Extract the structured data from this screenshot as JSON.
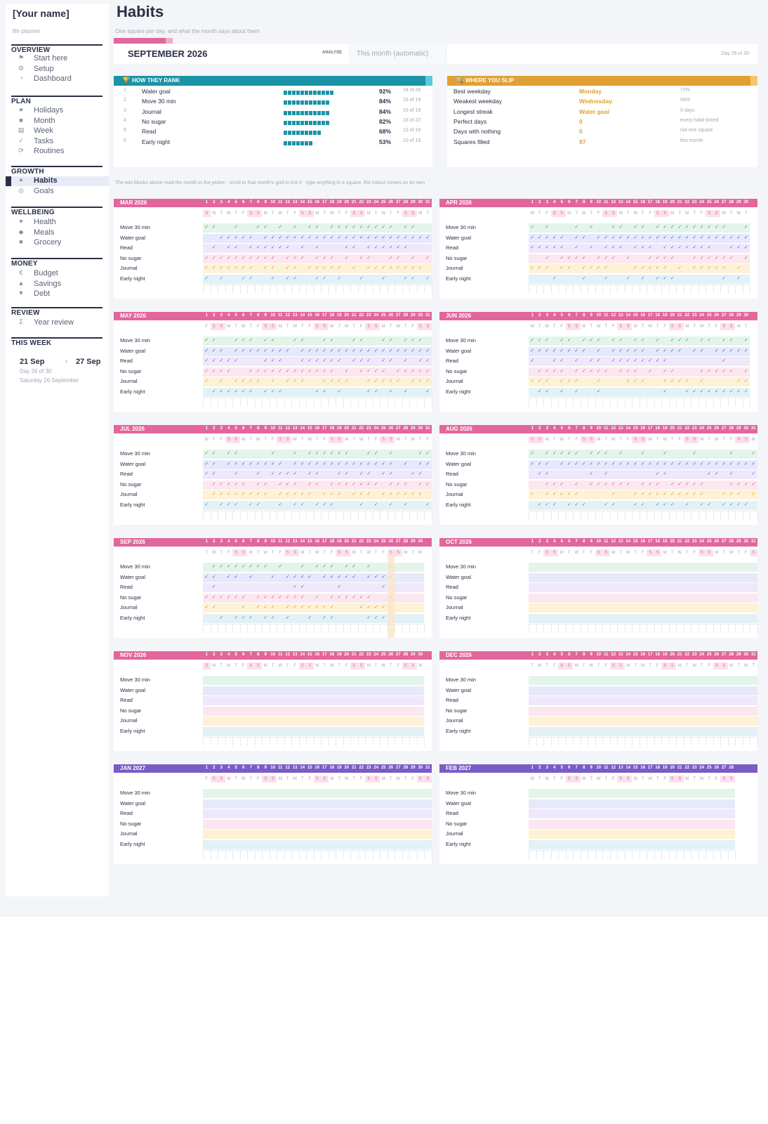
{
  "sidebar": {
    "name": "[Your name]",
    "subtitle": "life planner",
    "sections": [
      {
        "title": "OVERVIEW",
        "items": [
          {
            "label": "Start here",
            "icon": "⚑",
            "icon_name": "flag-icon"
          },
          {
            "label": "Setup",
            "icon": "⚙",
            "icon_name": "gear-icon"
          },
          {
            "label": "Dashboard",
            "icon": "◔",
            "icon_name": "dashboard-icon"
          }
        ]
      },
      {
        "title": "PLAN",
        "items": [
          {
            "label": "Holidays",
            "icon": "★",
            "icon_name": "star-icon"
          },
          {
            "label": "Month",
            "icon": "■",
            "icon_name": "month-icon"
          },
          {
            "label": "Week",
            "icon": "▤",
            "icon_name": "week-icon"
          },
          {
            "label": "Tasks",
            "icon": "✓",
            "icon_name": "check-icon"
          },
          {
            "label": "Routines",
            "icon": "⟳",
            "icon_name": "refresh-icon"
          }
        ]
      },
      {
        "title": "GROWTH",
        "items": [
          {
            "label": "Habits",
            "icon": "●",
            "icon_name": "dot-icon",
            "active": true
          },
          {
            "label": "Goals",
            "icon": "◎",
            "icon_name": "target-icon"
          }
        ]
      },
      {
        "title": "WELLBEING",
        "items": [
          {
            "label": "Health",
            "icon": "♥",
            "icon_name": "heart-icon"
          },
          {
            "label": "Meals",
            "icon": "◆",
            "icon_name": "meals-icon"
          },
          {
            "label": "Grocery",
            "icon": "■",
            "icon_name": "grocery-icon"
          }
        ]
      },
      {
        "title": "MONEY",
        "items": [
          {
            "label": "Budget",
            "icon": "€",
            "icon_name": "euro-icon"
          },
          {
            "label": "Savings",
            "icon": "▲",
            "icon_name": "savings-icon"
          },
          {
            "label": "Debt",
            "icon": "▼",
            "icon_name": "debt-icon"
          }
        ]
      },
      {
        "title": "REVIEW",
        "items": [
          {
            "label": "Year review",
            "icon": "Σ",
            "icon_name": "sigma-icon"
          }
        ]
      }
    ],
    "this_week": {
      "title": "THIS WEEK",
      "from": "21 Sep",
      "arrow": "›",
      "to": "27 Sep",
      "day": "Day 26 of 30",
      "date": "Saturday 26 September"
    }
  },
  "header": {
    "title": "Habits",
    "subtitle": "One square per day, and what the month says about them",
    "month": "SEPTEMBER 2026",
    "analyse_label": "ANALYSE",
    "auto_label": "This month (automatic)",
    "day_counter": "Day 26 of 30"
  },
  "rank": {
    "title": "HOW THEY RANK",
    "icon": "🏆",
    "rows": [
      {
        "rank": "1",
        "habit": "Water goal",
        "blocks": 12,
        "pct": "92%",
        "count": "24 of 26"
      },
      {
        "rank": "2",
        "habit": "Move 30 min",
        "blocks": 11,
        "pct": "84%",
        "count": "16 of 19"
      },
      {
        "rank": "3",
        "habit": "Journal",
        "blocks": 11,
        "pct": "84%",
        "count": "16 of 19"
      },
      {
        "rank": "4",
        "habit": "No sugar",
        "blocks": 11,
        "pct": "82%",
        "count": "18 of 22"
      },
      {
        "rank": "5",
        "habit": "Read",
        "blocks": 9,
        "pct": "68%",
        "count": "13 of 19"
      },
      {
        "rank": "6",
        "habit": "Early night",
        "blocks": 7,
        "pct": "53%",
        "count": "10 of 19"
      }
    ]
  },
  "slip": {
    "title": "WHERE YOU SLIP",
    "icon": "🔍",
    "rows": [
      {
        "label": "Best weekday",
        "value": "Monday",
        "note": "72%"
      },
      {
        "label": "Weakest weekday",
        "value": "Wednesday",
        "note": "54%"
      },
      {
        "label": "Longest streak",
        "value": "Water goal",
        "note": "9 days"
      },
      {
        "label": "Perfect days",
        "value": "0",
        "note": "every habit ticked"
      },
      {
        "label": "Days with nothing",
        "value": "0",
        "note": "not one square"
      },
      {
        "label": "Squares filled",
        "value": "97",
        "note": "this month"
      }
    ]
  },
  "note": "The two blocks above read the month in the picker  ·  scroll to that month's grid to tick it  ·  type anything in a square, the colour comes on its own",
  "habits": [
    "Move 30 min",
    "Water goal",
    "Read",
    "No sugar",
    "Journal",
    "Early night"
  ],
  "check_symbol": "✓",
  "colors": {
    "accent_pink": "#e2669b",
    "accent_teal": "#1b93a6",
    "accent_orange": "#e0a033",
    "accent_purple": "#7b5bc6",
    "bands": [
      "#e3f4ea",
      "#e6e9fb",
      "#efe8fb",
      "#fbe7ef",
      "#fdf1d6",
      "#e2f1f6"
    ],
    "checks": [
      "#2e9d5e",
      "#3f5bd1",
      "#7a4fc8",
      "#e0557f",
      "#d99a1c",
      "#2794ab"
    ]
  },
  "months": [
    {
      "name": "MAR 2026",
      "days": 31,
      "weekdays": "SMTWTFSSMTWTFSSMTWTFSSMTWTFSSMT",
      "filled": 31
    },
    {
      "name": "APR 2026",
      "days": 30,
      "weekdays": "WTFSSMTWTFSSMTWTFSSMTWTFSSMTWT",
      "filled": 30
    },
    {
      "name": "MAY 2026",
      "days": 31,
      "weekdays": "FSSMTWTFSSMTWTFSSMTWTFSSMTWTFSS",
      "filled": 31
    },
    {
      "name": "JUN 2026",
      "days": 30,
      "weekdays": "MTWTFSSMTWTFSSMTWTFSSMTWTFSSMT",
      "filled": 30
    },
    {
      "name": "JUL 2026",
      "days": 31,
      "weekdays": "WTFSSMTWTFSSMTWTFSSMTWTFSSMTWTF",
      "filled": 31
    },
    {
      "name": "AUG 2026",
      "days": 31,
      "weekdays": "SSMTWTFSSMTWTFSSMTWTFSSMTWTFSSM",
      "filled": 31
    },
    {
      "name": "SEP 2026",
      "days": 30,
      "weekdays": "TWTFSSMTWTFSSMTWTFSSMTWTFSSMTW",
      "filled": 26,
      "today": 26
    },
    {
      "name": "OCT 2026",
      "days": 31,
      "weekdays": "TFSSMTWTFSSMTWTFSSMTWTFSSMTWTFS",
      "filled": 0
    },
    {
      "name": "NOV 2026",
      "days": 30,
      "weekdays": "SMTWTFSSMTWTFSSMTWTFSSMTWTFSSM",
      "filled": 0
    },
    {
      "name": "DEC 2026",
      "days": 31,
      "weekdays": "TWTFSSMTWTFSSMTWTFSSMTWTFSSMTWT",
      "filled": 0
    },
    {
      "name": "JAN 2027",
      "days": 31,
      "weekdays": "FSSMTWTFSSMTWTFSSMTWTFSSMTWTFSS",
      "filled": 0,
      "purple": true
    },
    {
      "name": "FEB 2027",
      "days": 28,
      "weekdays": "MTWTFSSMTWTFSSMTWTFSSMTWTFSS",
      "filled": 0,
      "purple": true
    }
  ]
}
